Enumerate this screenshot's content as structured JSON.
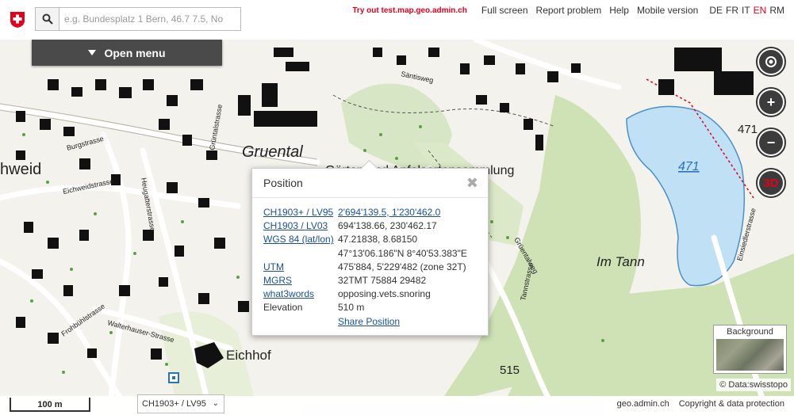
{
  "header": {
    "search_placeholder": "e.g. Bundesplatz 1 Bern, 46.7 7.5, No",
    "promo": "Try out test.map.geo.admin.ch",
    "links": [
      "Full screen",
      "Report problem",
      "Help",
      "Mobile version"
    ],
    "languages": [
      "DE",
      "FR",
      "IT",
      "EN",
      "RM"
    ],
    "active_language": "EN"
  },
  "menu": {
    "label": "Open menu"
  },
  "map": {
    "labels": {
      "gruental": "Gruental",
      "gaertner": "Gärten und Apfelsortensammlung",
      "hweid": "hweid",
      "im_tann": "Im Tann",
      "eichhof": "Eichhof",
      "lake_height": "471",
      "height_471": "471",
      "height_515": "515",
      "burgstrasse": "Burgstrasse",
      "eichweidstrasse": "Eichweidstrasse",
      "heugatterstrasse": "Heugatterstrasse",
      "frohbuehlstrasse": "Frohbühlstrasse",
      "walterhauser": "Walterhauser-Strasse",
      "tannstrasse": "Tannstrasse",
      "gruentalweg": "Grüentalweg",
      "einsiedlerstrasse": "Einsiedlerstrasse",
      "saentisweg": "Säntisweg",
      "gruentalstrasse": "Grüntalstrasse"
    }
  },
  "controls": {
    "zoom_in": "+",
    "zoom_out": "−",
    "view3d": "3D"
  },
  "popup": {
    "title": "Position",
    "rows": [
      {
        "k": "CH1903+ / LV95",
        "v": "2'694'139.5, 1'230'462.0"
      },
      {
        "k": "CH1903 / LV03",
        "v": "694'138.66, 230'462.17"
      },
      {
        "k": "WGS 84 (lat/lon)",
        "v": "47.21838, 8.68150"
      },
      {
        "k": "",
        "v": "47°13'06.186\"N 8°40'53.383\"E"
      },
      {
        "k": "UTM",
        "v": "475'884, 5'229'482 (zone 32T)"
      },
      {
        "k": "MGRS",
        "v": "32TMT 75884 29482"
      },
      {
        "k": "what3words",
        "v": "opposing.vets.snoring"
      },
      {
        "k": "Elevation",
        "v": "510 m"
      },
      {
        "k": "",
        "v": "Share Position"
      }
    ]
  },
  "background": {
    "label": "Background"
  },
  "credit": "© Data:swisstopo",
  "footer": {
    "scale": "100 m",
    "projection": "CH1903+ / LV95",
    "links": [
      "geo.admin.ch",
      "Copyright & data protection"
    ]
  }
}
